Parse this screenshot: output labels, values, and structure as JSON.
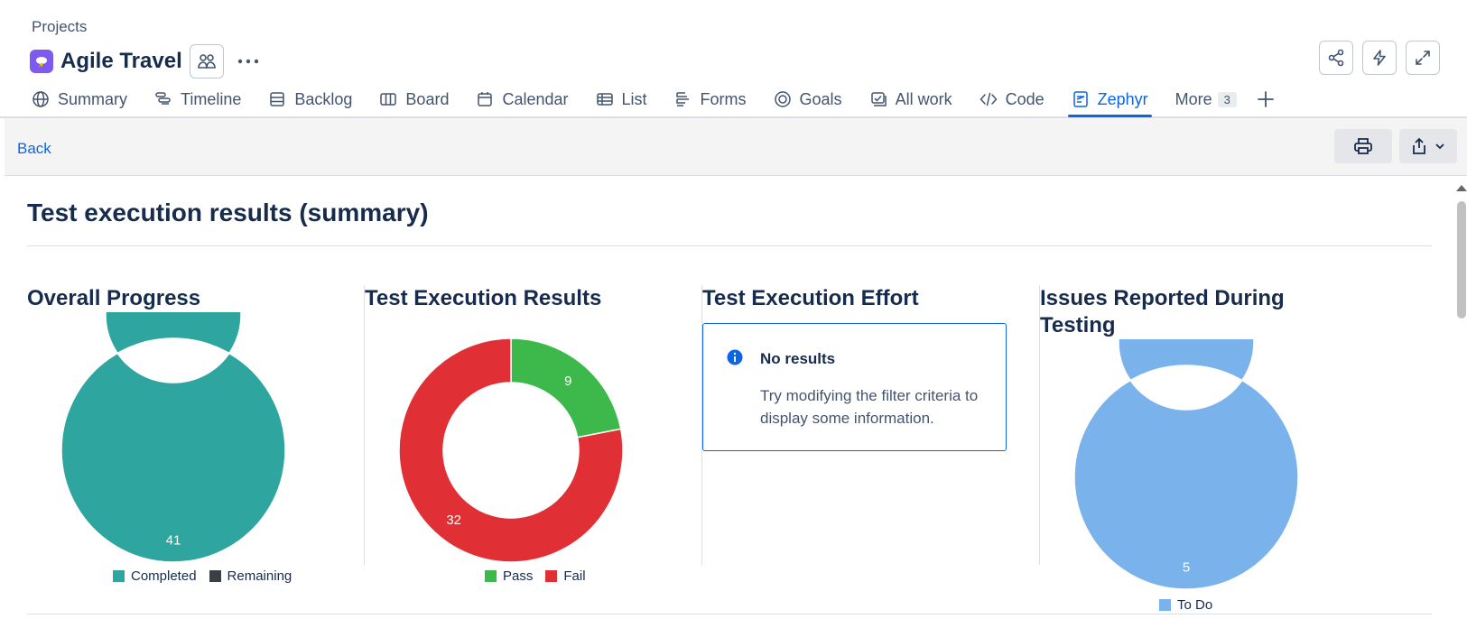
{
  "header": {
    "breadcrumb": "Projects",
    "project_title": "Agile Travel"
  },
  "tabs": [
    {
      "label": "Summary",
      "icon": "globe-icon"
    },
    {
      "label": "Timeline",
      "icon": "timeline-icon"
    },
    {
      "label": "Backlog",
      "icon": "backlog-icon"
    },
    {
      "label": "Board",
      "icon": "board-icon"
    },
    {
      "label": "Calendar",
      "icon": "calendar-icon"
    },
    {
      "label": "List",
      "icon": "list-icon"
    },
    {
      "label": "Forms",
      "icon": "forms-icon"
    },
    {
      "label": "Goals",
      "icon": "goals-icon"
    },
    {
      "label": "All work",
      "icon": "all-work-icon"
    },
    {
      "label": "Code",
      "icon": "code-icon"
    },
    {
      "label": "Zephyr",
      "icon": "zephyr-icon",
      "active": true
    },
    {
      "label": "More",
      "badge": "3"
    }
  ],
  "toolbar": {
    "back_label": "Back"
  },
  "report": {
    "title": "Test execution results (summary)"
  },
  "panels": {
    "overall_progress": {
      "title": "Overall Progress"
    },
    "execution_results": {
      "title": "Test Execution Results"
    },
    "execution_effort": {
      "title": "Test Execution Effort",
      "no_results_title": "No results",
      "no_results_text": "Try modifying the filter criteria to display some information."
    },
    "issues_reported": {
      "title": "Issues Reported During Testing"
    }
  },
  "colors": {
    "accent": "#0c66e4",
    "completed": "#2ea59e",
    "remaining": "#3b3f45",
    "pass": "#3cb94a",
    "fail": "#e03036",
    "todo": "#7ab2eb"
  },
  "chart_data": [
    {
      "type": "pie",
      "title": "Overall Progress",
      "categories": [
        "Completed",
        "Remaining"
      ],
      "values": [
        41,
        0
      ],
      "colors": [
        "#2ea59e",
        "#3b3f45"
      ],
      "legend": "bottom"
    },
    {
      "type": "pie",
      "title": "Test Execution Results",
      "categories": [
        "Pass",
        "Fail"
      ],
      "values": [
        9,
        32
      ],
      "colors": [
        "#3cb94a",
        "#e03036"
      ],
      "legend": "bottom"
    },
    {
      "type": "pie",
      "title": "Issues Reported During Testing",
      "categories": [
        "To Do"
      ],
      "values": [
        5
      ],
      "colors": [
        "#7ab2eb"
      ],
      "legend": "bottom"
    }
  ]
}
